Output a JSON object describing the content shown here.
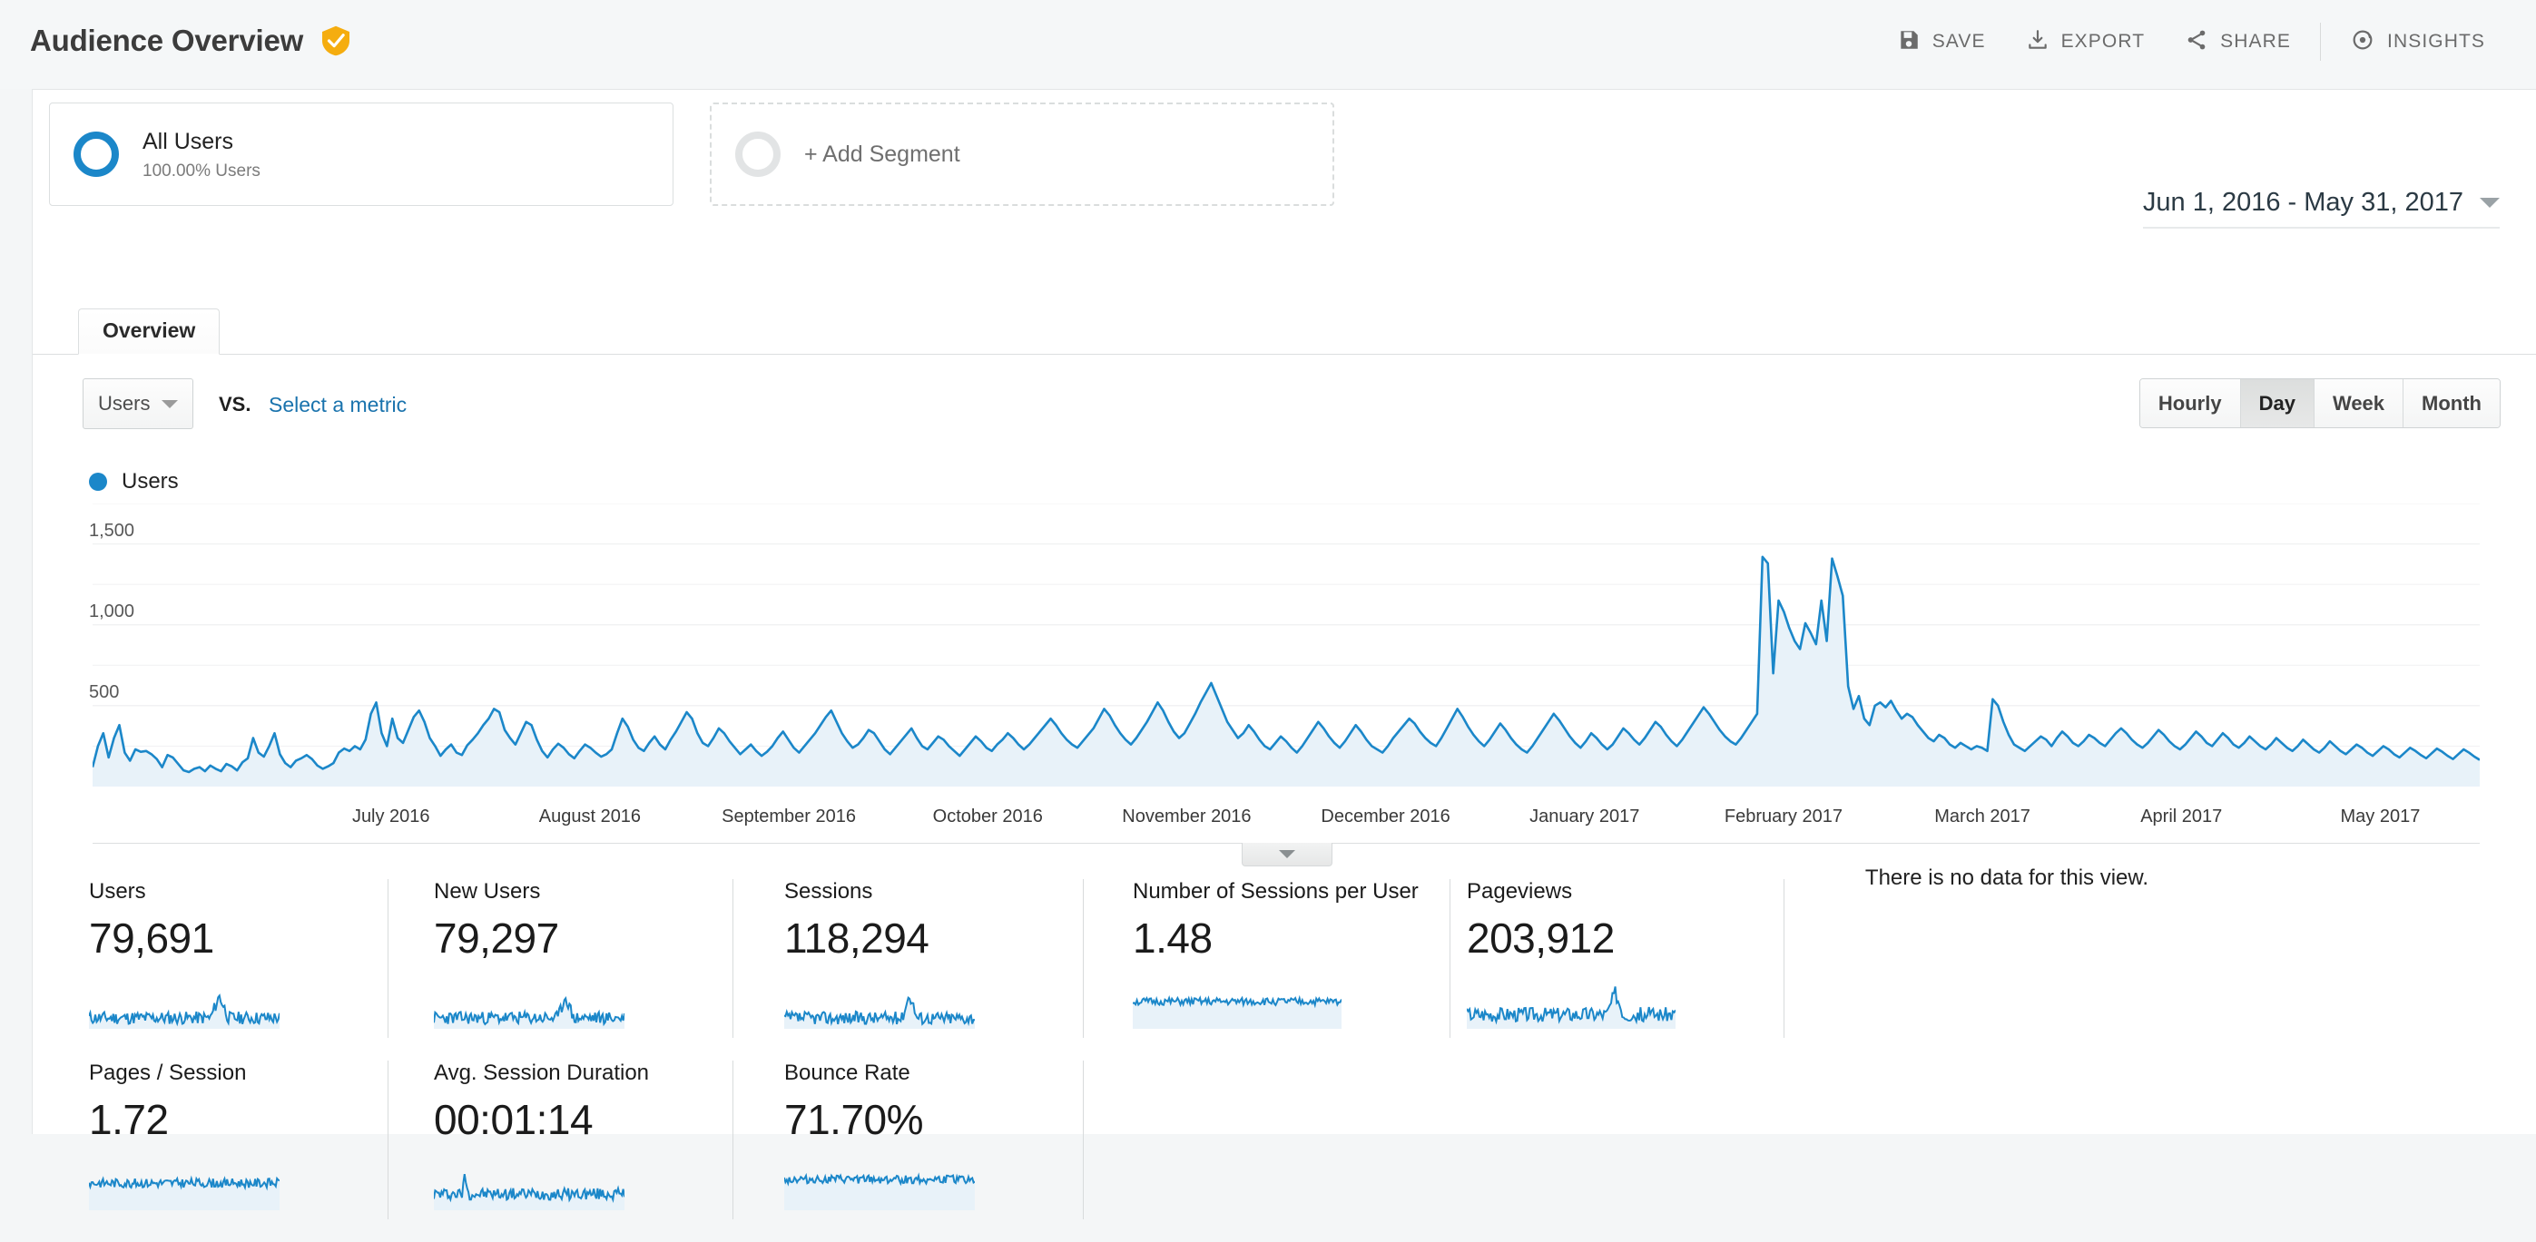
{
  "header": {
    "title": "Audience Overview",
    "badge_icon": "verified-shield-icon",
    "badge_color": "#f5ad0f",
    "actions": [
      {
        "label": "SAVE",
        "icon": "save-icon"
      },
      {
        "label": "EXPORT",
        "icon": "export-download-icon"
      },
      {
        "label": "SHARE",
        "icon": "share-icon"
      },
      {
        "label": "INSIGHTS",
        "icon": "insights-atom-icon"
      }
    ]
  },
  "segments": {
    "all_users": {
      "name": "All Users",
      "sub": "100.00% Users"
    },
    "add_segment": {
      "label": "+ Add Segment"
    }
  },
  "date_range": {
    "value": "Jun 1, 2016 - May 31, 2017",
    "icon": "chevron-down-icon"
  },
  "tabs": [
    {
      "label": "Overview",
      "active": true
    }
  ],
  "metric_selector": {
    "primary_metric": "Users",
    "vs_label": "VS.",
    "select_metric_link": "Select a metric"
  },
  "granularity": {
    "options": [
      "Hourly",
      "Day",
      "Week",
      "Month"
    ],
    "selected": "Day"
  },
  "chart_legend": {
    "label": "Users",
    "color": "#1b87c9"
  },
  "messages": {
    "no_data": "There is no data for this view."
  },
  "metric_cards_row1": [
    {
      "label": "Users",
      "value": "79,691"
    },
    {
      "label": "New Users",
      "value": "79,297"
    },
    {
      "label": "Sessions",
      "value": "118,294"
    },
    {
      "label": "Number of Sessions per User",
      "value": "1.48"
    },
    {
      "label": "Pageviews",
      "value": "203,912"
    }
  ],
  "metric_cards_row2": [
    {
      "label": "Pages / Session",
      "value": "1.72"
    },
    {
      "label": "Avg. Session Duration",
      "value": "00:01:14"
    },
    {
      "label": "Bounce Rate",
      "value": "71.70%"
    }
  ],
  "chart_data": {
    "type": "area",
    "title": "Users",
    "xlabel": "",
    "ylabel": "Users",
    "ylim": [
      0,
      1750
    ],
    "yticks": [
      500,
      1000,
      1500
    ],
    "ytick_labels": [
      "500",
      "1,000",
      "1,500"
    ],
    "grid": true,
    "legend_position": "top-left",
    "line_color": "#1b87c9",
    "fill_color": "#e8f2f9",
    "x_tick_labels": [
      "July 2016",
      "August 2016",
      "September 2016",
      "October 2016",
      "November 2016",
      "December 2016",
      "January 2017",
      "February 2017",
      "March 2017",
      "April 2017",
      "May 2017"
    ],
    "x_range": "Jun 1, 2016 - May 31, 2017",
    "granularity": "Day",
    "values": [
      120,
      250,
      330,
      180,
      300,
      380,
      210,
      160,
      230,
      215,
      220,
      200,
      170,
      120,
      195,
      180,
      140,
      100,
      90,
      110,
      120,
      95,
      130,
      110,
      95,
      140,
      125,
      100,
      150,
      175,
      300,
      210,
      185,
      250,
      330,
      200,
      145,
      120,
      160,
      175,
      195,
      170,
      130,
      110,
      125,
      145,
      210,
      235,
      220,
      250,
      230,
      290,
      450,
      520,
      330,
      250,
      420,
      300,
      270,
      350,
      430,
      470,
      400,
      300,
      250,
      190,
      230,
      260,
      210,
      195,
      255,
      290,
      330,
      380,
      420,
      480,
      460,
      350,
      300,
      260,
      330,
      400,
      380,
      290,
      220,
      180,
      230,
      265,
      240,
      200,
      175,
      220,
      260,
      240,
      210,
      185,
      200,
      230,
      330,
      420,
      370,
      290,
      240,
      220,
      270,
      310,
      260,
      230,
      290,
      340,
      400,
      460,
      420,
      330,
      270,
      250,
      300,
      360,
      330,
      280,
      240,
      200,
      230,
      260,
      220,
      190,
      215,
      250,
      300,
      340,
      290,
      240,
      210,
      250,
      290,
      330,
      380,
      430,
      470,
      400,
      330,
      280,
      240,
      260,
      300,
      350,
      330,
      280,
      230,
      200,
      240,
      280,
      320,
      360,
      300,
      250,
      230,
      270,
      310,
      290,
      250,
      220,
      190,
      230,
      270,
      310,
      280,
      240,
      220,
      260,
      290,
      330,
      300,
      260,
      230,
      260,
      300,
      340,
      380,
      420,
      380,
      330,
      290,
      260,
      240,
      280,
      320,
      360,
      420,
      480,
      440,
      380,
      330,
      290,
      260,
      300,
      350,
      400,
      460,
      520,
      470,
      400,
      340,
      300,
      330,
      390,
      450,
      520,
      580,
      640,
      560,
      480,
      400,
      350,
      300,
      330,
      380,
      340,
      290,
      250,
      230,
      270,
      310,
      280,
      240,
      210,
      250,
      300,
      350,
      400,
      360,
      310,
      270,
      240,
      280,
      330,
      380,
      340,
      290,
      250,
      230,
      210,
      250,
      300,
      340,
      380,
      420,
      390,
      340,
      300,
      270,
      250,
      300,
      360,
      420,
      480,
      430,
      370,
      320,
      280,
      250,
      290,
      340,
      390,
      350,
      300,
      260,
      230,
      210,
      250,
      300,
      350,
      400,
      450,
      410,
      360,
      310,
      270,
      240,
      280,
      330,
      300,
      260,
      230,
      260,
      310,
      360,
      330,
      290,
      260,
      300,
      350,
      400,
      370,
      320,
      280,
      250,
      290,
      340,
      390,
      440,
      490,
      450,
      400,
      350,
      310,
      280,
      260,
      300,
      350,
      400,
      450,
      1420,
      1380,
      700,
      1150,
      1080,
      980,
      900,
      850,
      1010,
      950,
      880,
      1150,
      900,
      1410,
      1300,
      1180,
      620,
      480,
      560,
      420,
      380,
      500,
      520,
      490,
      530,
      470,
      420,
      450,
      430,
      380,
      340,
      300,
      280,
      320,
      300,
      260,
      240,
      270,
      250,
      230,
      250,
      240,
      220,
      540,
      500,
      400,
      320,
      260,
      240,
      220,
      250,
      280,
      310,
      290,
      250,
      300,
      340,
      310,
      270,
      250,
      280,
      320,
      300,
      270,
      250,
      290,
      330,
      360,
      330,
      290,
      260,
      240,
      270,
      310,
      350,
      320,
      280,
      250,
      230,
      260,
      300,
      340,
      310,
      270,
      250,
      290,
      330,
      300,
      260,
      240,
      270,
      310,
      280,
      250,
      230,
      260,
      300,
      270,
      240,
      220,
      250,
      290,
      260,
      230,
      210,
      240,
      280,
      250,
      220,
      200,
      230,
      260,
      240,
      210,
      190,
      220,
      250,
      230,
      200,
      180,
      210,
      240,
      220,
      195,
      175,
      205,
      235,
      215,
      190,
      170,
      200,
      230,
      210,
      185,
      165
    ]
  }
}
